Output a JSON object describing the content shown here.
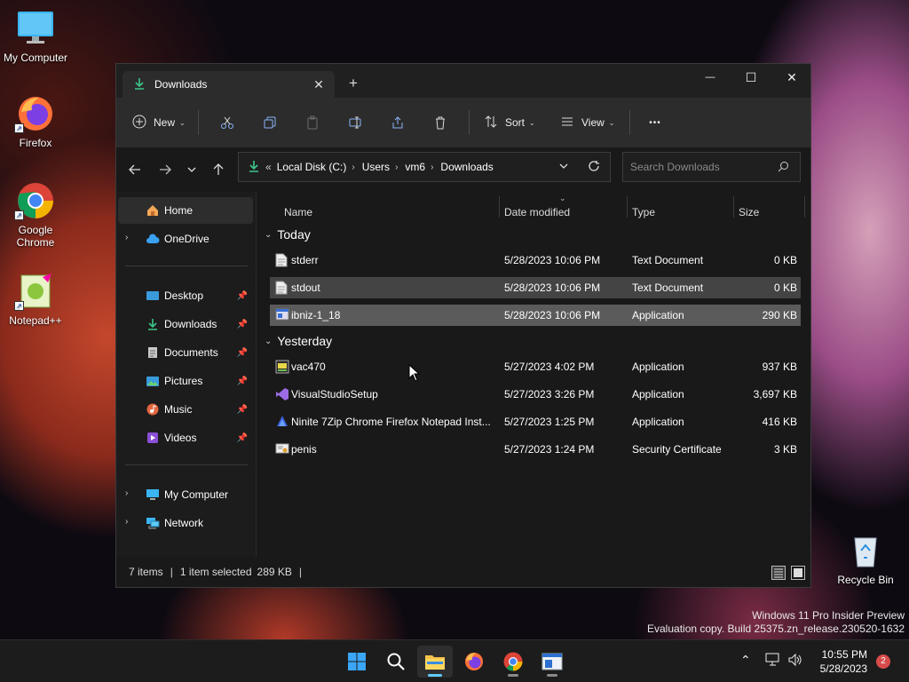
{
  "desktop": {
    "icons": [
      {
        "label": "My Computer"
      },
      {
        "label": "Firefox"
      },
      {
        "label": "Google Chrome"
      },
      {
        "label": "Notepad++"
      },
      {
        "label": "Recycle Bin"
      }
    ],
    "watermark": {
      "line1": "Windows 11 Pro Insider Preview",
      "line2": "Evaluation copy. Build 25375.zn_release.230520-1632"
    }
  },
  "window": {
    "tab": {
      "title": "Downloads",
      "close": "✕",
      "new": "+"
    },
    "controls": {
      "minimize": "—",
      "maximize": "☐",
      "close": "✕"
    },
    "toolbar": {
      "new_label": "New",
      "sort_label": "Sort",
      "view_label": "View",
      "more_label": "•••"
    },
    "address": {
      "prefix": "«",
      "crumbs": [
        "Local Disk (C:)",
        "Users",
        "vm6",
        "Downloads"
      ]
    },
    "search": {
      "placeholder": "Search Downloads"
    },
    "sidebar": {
      "items": [
        {
          "label": "Home"
        },
        {
          "label": "OneDrive"
        },
        {
          "label": "Desktop"
        },
        {
          "label": "Downloads"
        },
        {
          "label": "Documents"
        },
        {
          "label": "Pictures"
        },
        {
          "label": "Music"
        },
        {
          "label": "Videos"
        },
        {
          "label": "My Computer"
        },
        {
          "label": "Network"
        }
      ]
    },
    "columns": {
      "name": "Name",
      "date": "Date modified",
      "type": "Type",
      "size": "Size"
    },
    "groups": {
      "today": "Today",
      "yesterday": "Yesterday"
    },
    "files": [
      {
        "name": "stderr",
        "date": "5/28/2023 10:06 PM",
        "type": "Text Document",
        "size": "0 KB"
      },
      {
        "name": "stdout",
        "date": "5/28/2023 10:06 PM",
        "type": "Text Document",
        "size": "0 KB"
      },
      {
        "name": "ibniz-1_18",
        "date": "5/28/2023 10:06 PM",
        "type": "Application",
        "size": "290 KB"
      },
      {
        "name": "vac470",
        "date": "5/27/2023 4:02 PM",
        "type": "Application",
        "size": "937 KB"
      },
      {
        "name": "VisualStudioSetup",
        "date": "5/27/2023 3:26 PM",
        "type": "Application",
        "size": "3,697 KB"
      },
      {
        "name": "Ninite 7Zip Chrome Firefox Notepad Inst...",
        "date": "5/27/2023 1:25 PM",
        "type": "Application",
        "size": "416 KB"
      },
      {
        "name": "penis",
        "date": "5/27/2023 1:24 PM",
        "type": "Security Certificate",
        "size": "3 KB"
      }
    ],
    "status": {
      "items": "7 items",
      "selected": "1 item selected",
      "size": "289 KB"
    }
  },
  "taskbar": {
    "time": "10:55 PM",
    "date": "5/28/2023",
    "notifications": "2"
  }
}
